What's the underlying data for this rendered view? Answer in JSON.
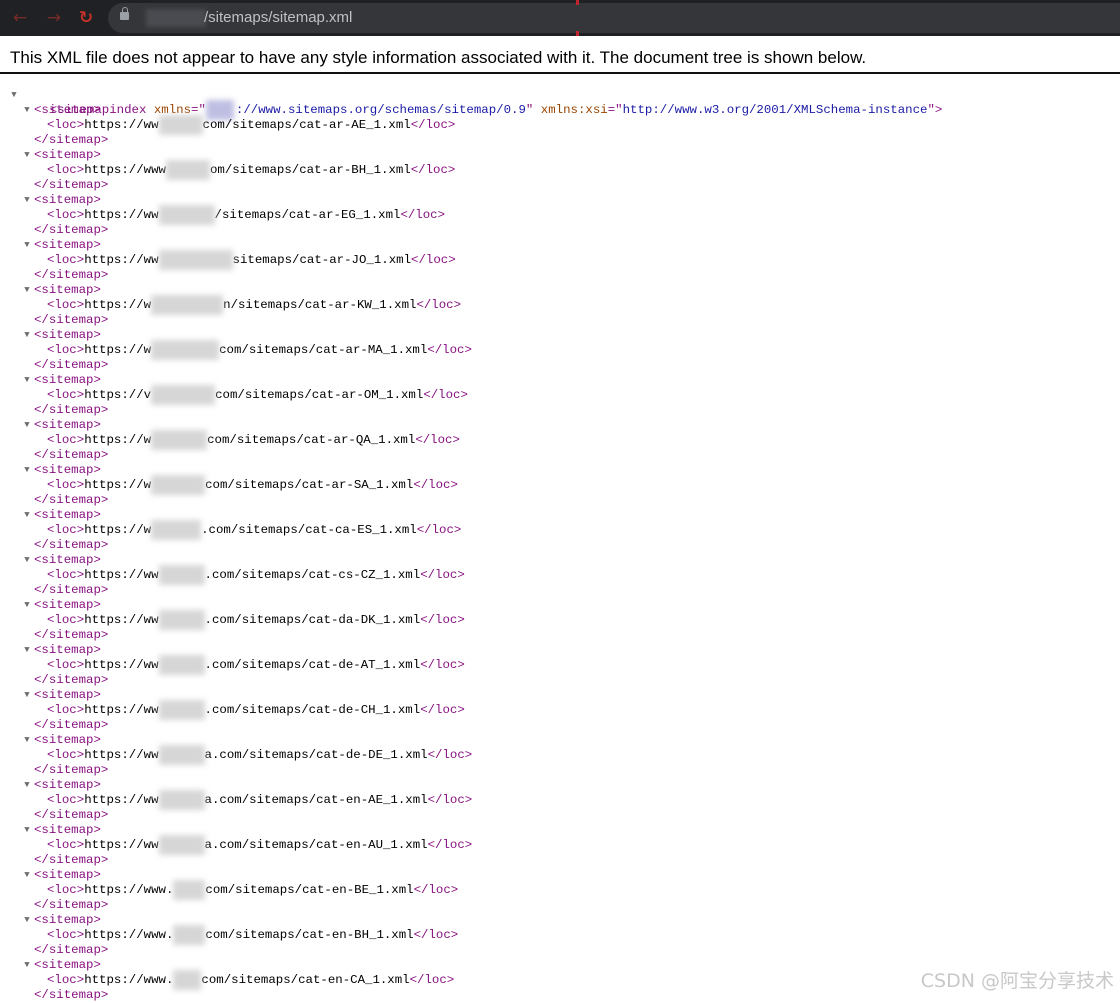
{
  "browser": {
    "url_path": "/sitemaps/sitemap.xml"
  },
  "notice": "This XML file does not appear to have any style information associated with it. The document tree is shown below.",
  "root": {
    "open_tag": "<sitemapindex",
    "xmlns_attr": "xmlns",
    "xmlns_value": "://www.sitemaps.org/schemas/sitemap/0.9",
    "xsi_attr": "xmlns:xsi",
    "xsi_value": "http://www.w3.org/2001/XMLSchema-instance"
  },
  "sitemap_open": "<sitemap>",
  "sitemap_close": "</sitemap>",
  "loc_open": "<loc>",
  "loc_close": "</loc>",
  "entries": [
    {
      "prefix": "https://ww",
      "path": "com/sitemaps/cat-ar-AE_1.xml"
    },
    {
      "prefix": "https://www",
      "path": "om/sitemaps/cat-ar-BH_1.xml"
    },
    {
      "prefix": "https://ww",
      "path": "/sitemaps/cat-ar-EG_1.xml"
    },
    {
      "prefix": "https://ww",
      "path": "sitemaps/cat-ar-JO_1.xml"
    },
    {
      "prefix": "https://w",
      "path": "n/sitemaps/cat-ar-KW_1.xml"
    },
    {
      "prefix": "https://w",
      "path": "com/sitemaps/cat-ar-MA_1.xml"
    },
    {
      "prefix": "https://v",
      "path": "com/sitemaps/cat-ar-OM_1.xml"
    },
    {
      "prefix": "https://w",
      "path": "com/sitemaps/cat-ar-QA_1.xml"
    },
    {
      "prefix": "https://w",
      "path": "com/sitemaps/cat-ar-SA_1.xml"
    },
    {
      "prefix": "https://w",
      "path": ".com/sitemaps/cat-ca-ES_1.xml"
    },
    {
      "prefix": "https://ww",
      "path": ".com/sitemaps/cat-cs-CZ_1.xml"
    },
    {
      "prefix": "https://ww",
      "path": ".com/sitemaps/cat-da-DK_1.xml"
    },
    {
      "prefix": "https://ww",
      "path": ".com/sitemaps/cat-de-AT_1.xml"
    },
    {
      "prefix": "https://ww",
      "path": ".com/sitemaps/cat-de-CH_1.xml"
    },
    {
      "prefix": "https://ww",
      "path": "a.com/sitemaps/cat-de-DE_1.xml"
    },
    {
      "prefix": "https://ww",
      "path": "a.com/sitemaps/cat-en-AE_1.xml"
    },
    {
      "prefix": "https://ww",
      "path": "a.com/sitemaps/cat-en-AU_1.xml"
    },
    {
      "prefix": "https://www.",
      "path": "com/sitemaps/cat-en-BE_1.xml"
    },
    {
      "prefix": "https://www.",
      "path": "com/sitemaps/cat-en-BH_1.xml"
    },
    {
      "prefix": "https://www.",
      "path": "com/sitemaps/cat-en-CA_1.xml"
    }
  ],
  "watermark": "CSDN @阿宝分享技术"
}
